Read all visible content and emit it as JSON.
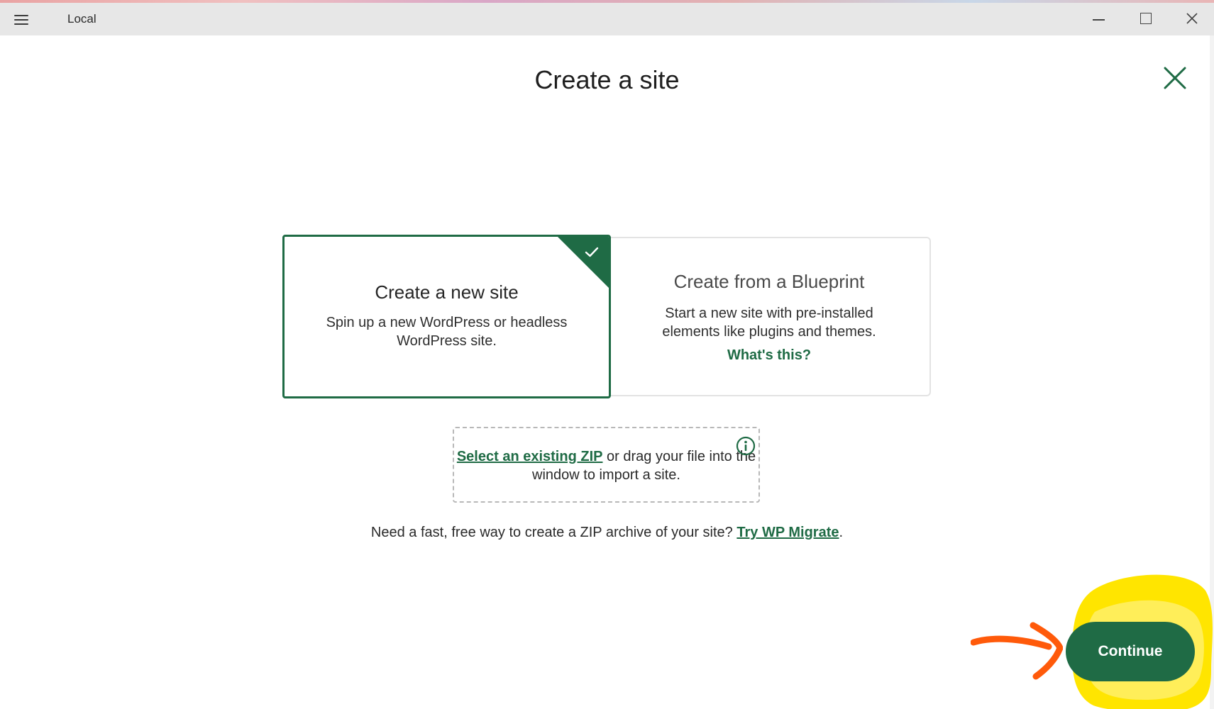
{
  "window": {
    "title": "Local",
    "menu_icon": "hamburger-menu-icon",
    "controls": [
      "minimize-icon",
      "maximize-icon",
      "close-icon"
    ]
  },
  "page": {
    "heading": "Create a site",
    "close_icon": "close-icon"
  },
  "options": {
    "new_site": {
      "title": "Create a new site",
      "description": "Spin up a new WordPress or headless WordPress site.",
      "selected": true,
      "selected_icon": "checkmark-icon"
    },
    "blueprint": {
      "title": "Create from a Blueprint",
      "description": "Start a new site with pre-installed elements like plugins and themes.",
      "link": "What's this?"
    }
  },
  "import": {
    "link": "Select an existing ZIP",
    "text_after_link": " or drag your file into the window to import a site.",
    "info_icon": "info-icon"
  },
  "migrate": {
    "text": "Need a fast, free way to create a ZIP archive of your site? ",
    "link": "Try WP Migrate",
    "suffix": "."
  },
  "actions": {
    "continue_label": "Continue"
  },
  "colors": {
    "accent": "#1f6b45",
    "highlight": "#ffe500",
    "arrow": "#ff5a0a"
  }
}
